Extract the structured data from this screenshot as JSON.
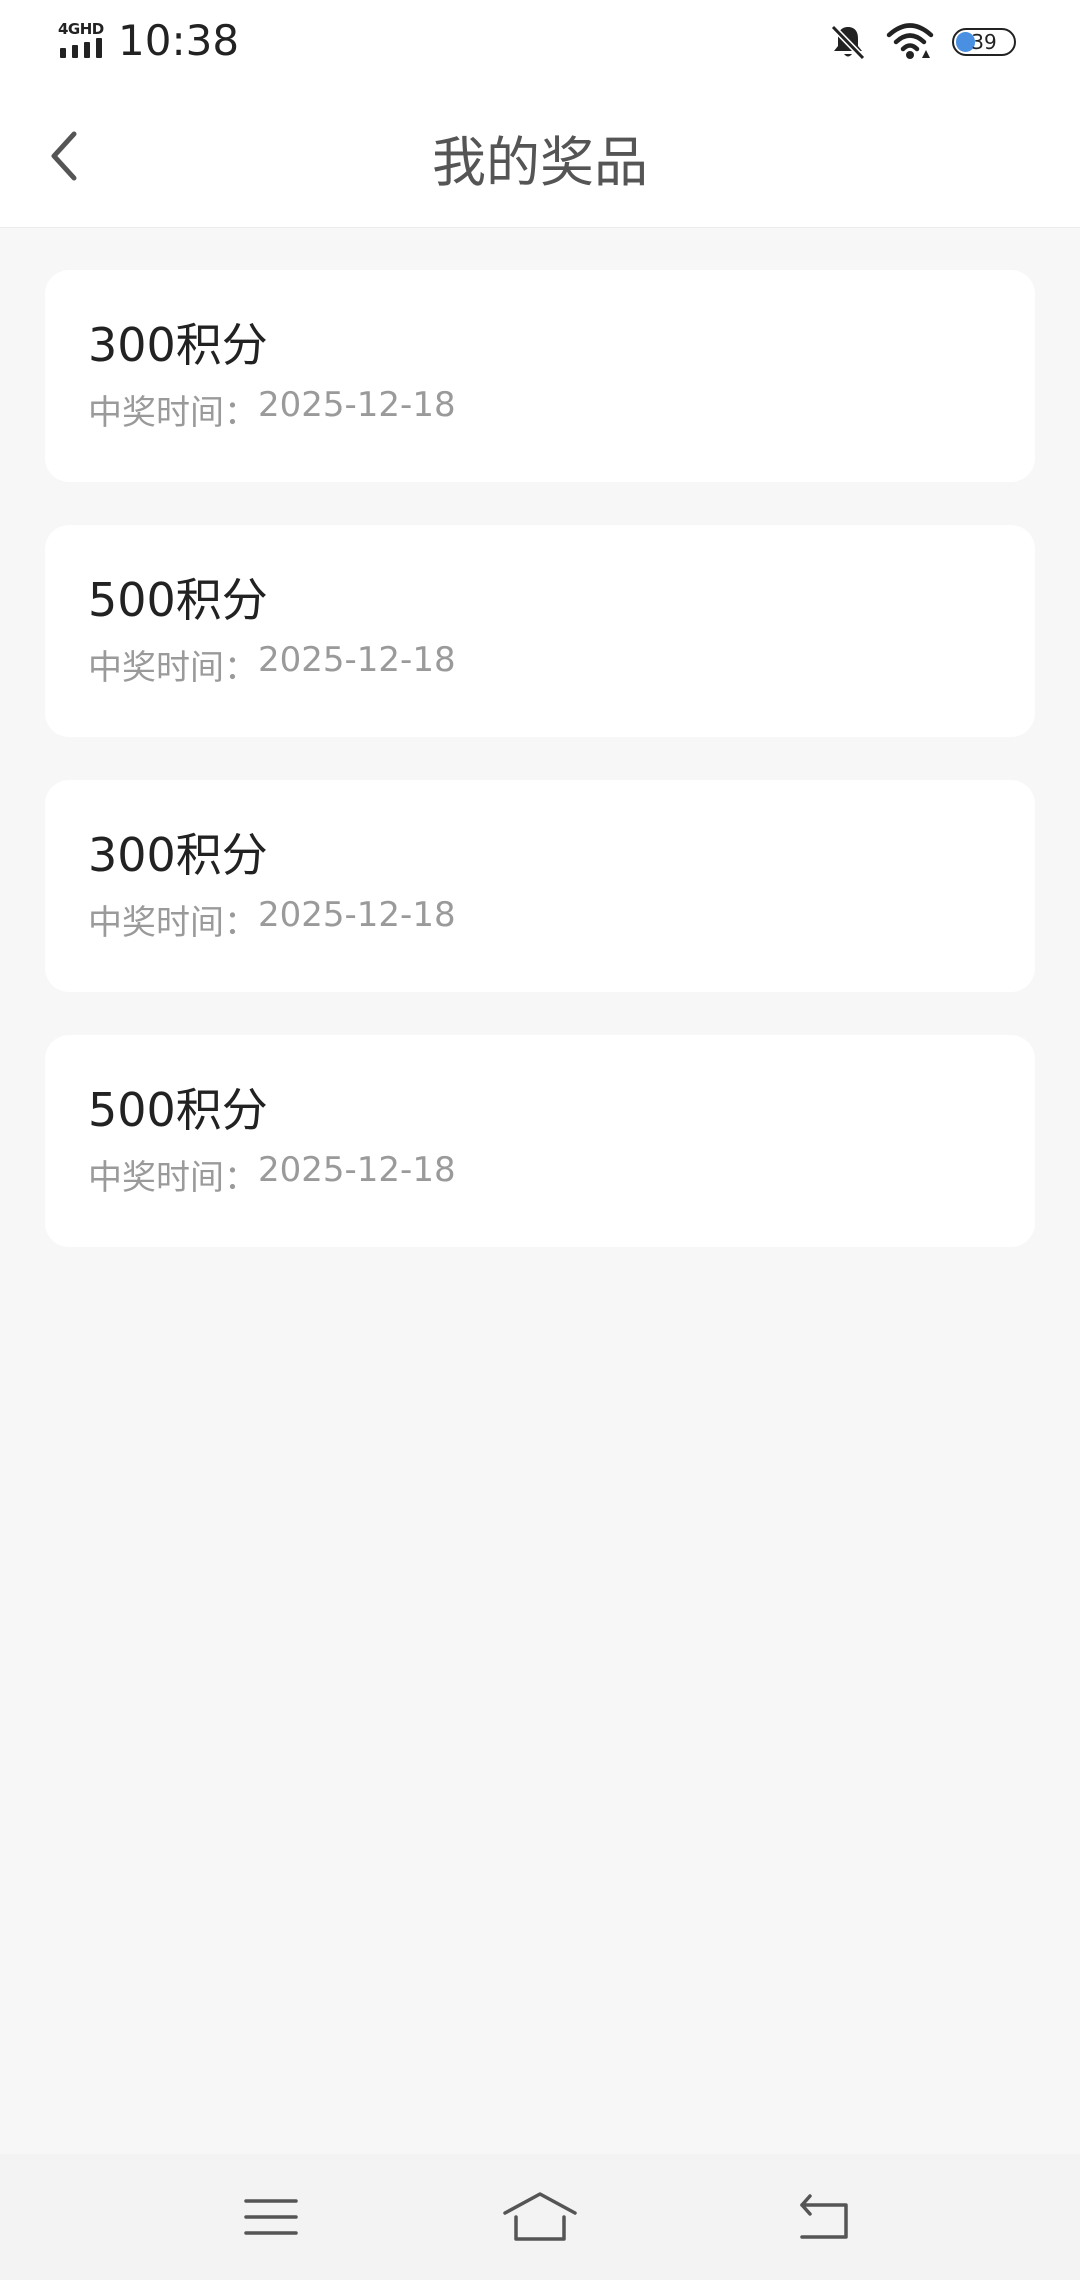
{
  "status_bar": {
    "network": "4GHD",
    "time": "10:38",
    "battery": "39",
    "battery_level": 0.39,
    "icons": [
      "signal-icon",
      "bell-muted-icon",
      "wifi-icon",
      "battery-icon"
    ]
  },
  "header": {
    "title": "我的奖品",
    "back_icon": "chevron-left-icon"
  },
  "prizes": [
    {
      "name": "300积分",
      "time_label": "中奖时间：",
      "date": "2025-12-18"
    },
    {
      "name": "500积分",
      "time_label": "中奖时间：",
      "date": "2025-12-18"
    },
    {
      "name": "300积分",
      "time_label": "中奖时间：",
      "date": "2025-12-18"
    },
    {
      "name": "500积分",
      "time_label": "中奖时间：",
      "date": "2025-12-18"
    }
  ],
  "system_nav": {
    "icons": [
      "menu-icon",
      "home-icon",
      "back-icon"
    ]
  },
  "colors": {
    "background": "#f7f7f7",
    "card": "#ffffff",
    "title": "#555555",
    "prize_text": "#222222",
    "secondary_text": "#9a9a9a",
    "battery_accent": "#4a90e2"
  }
}
